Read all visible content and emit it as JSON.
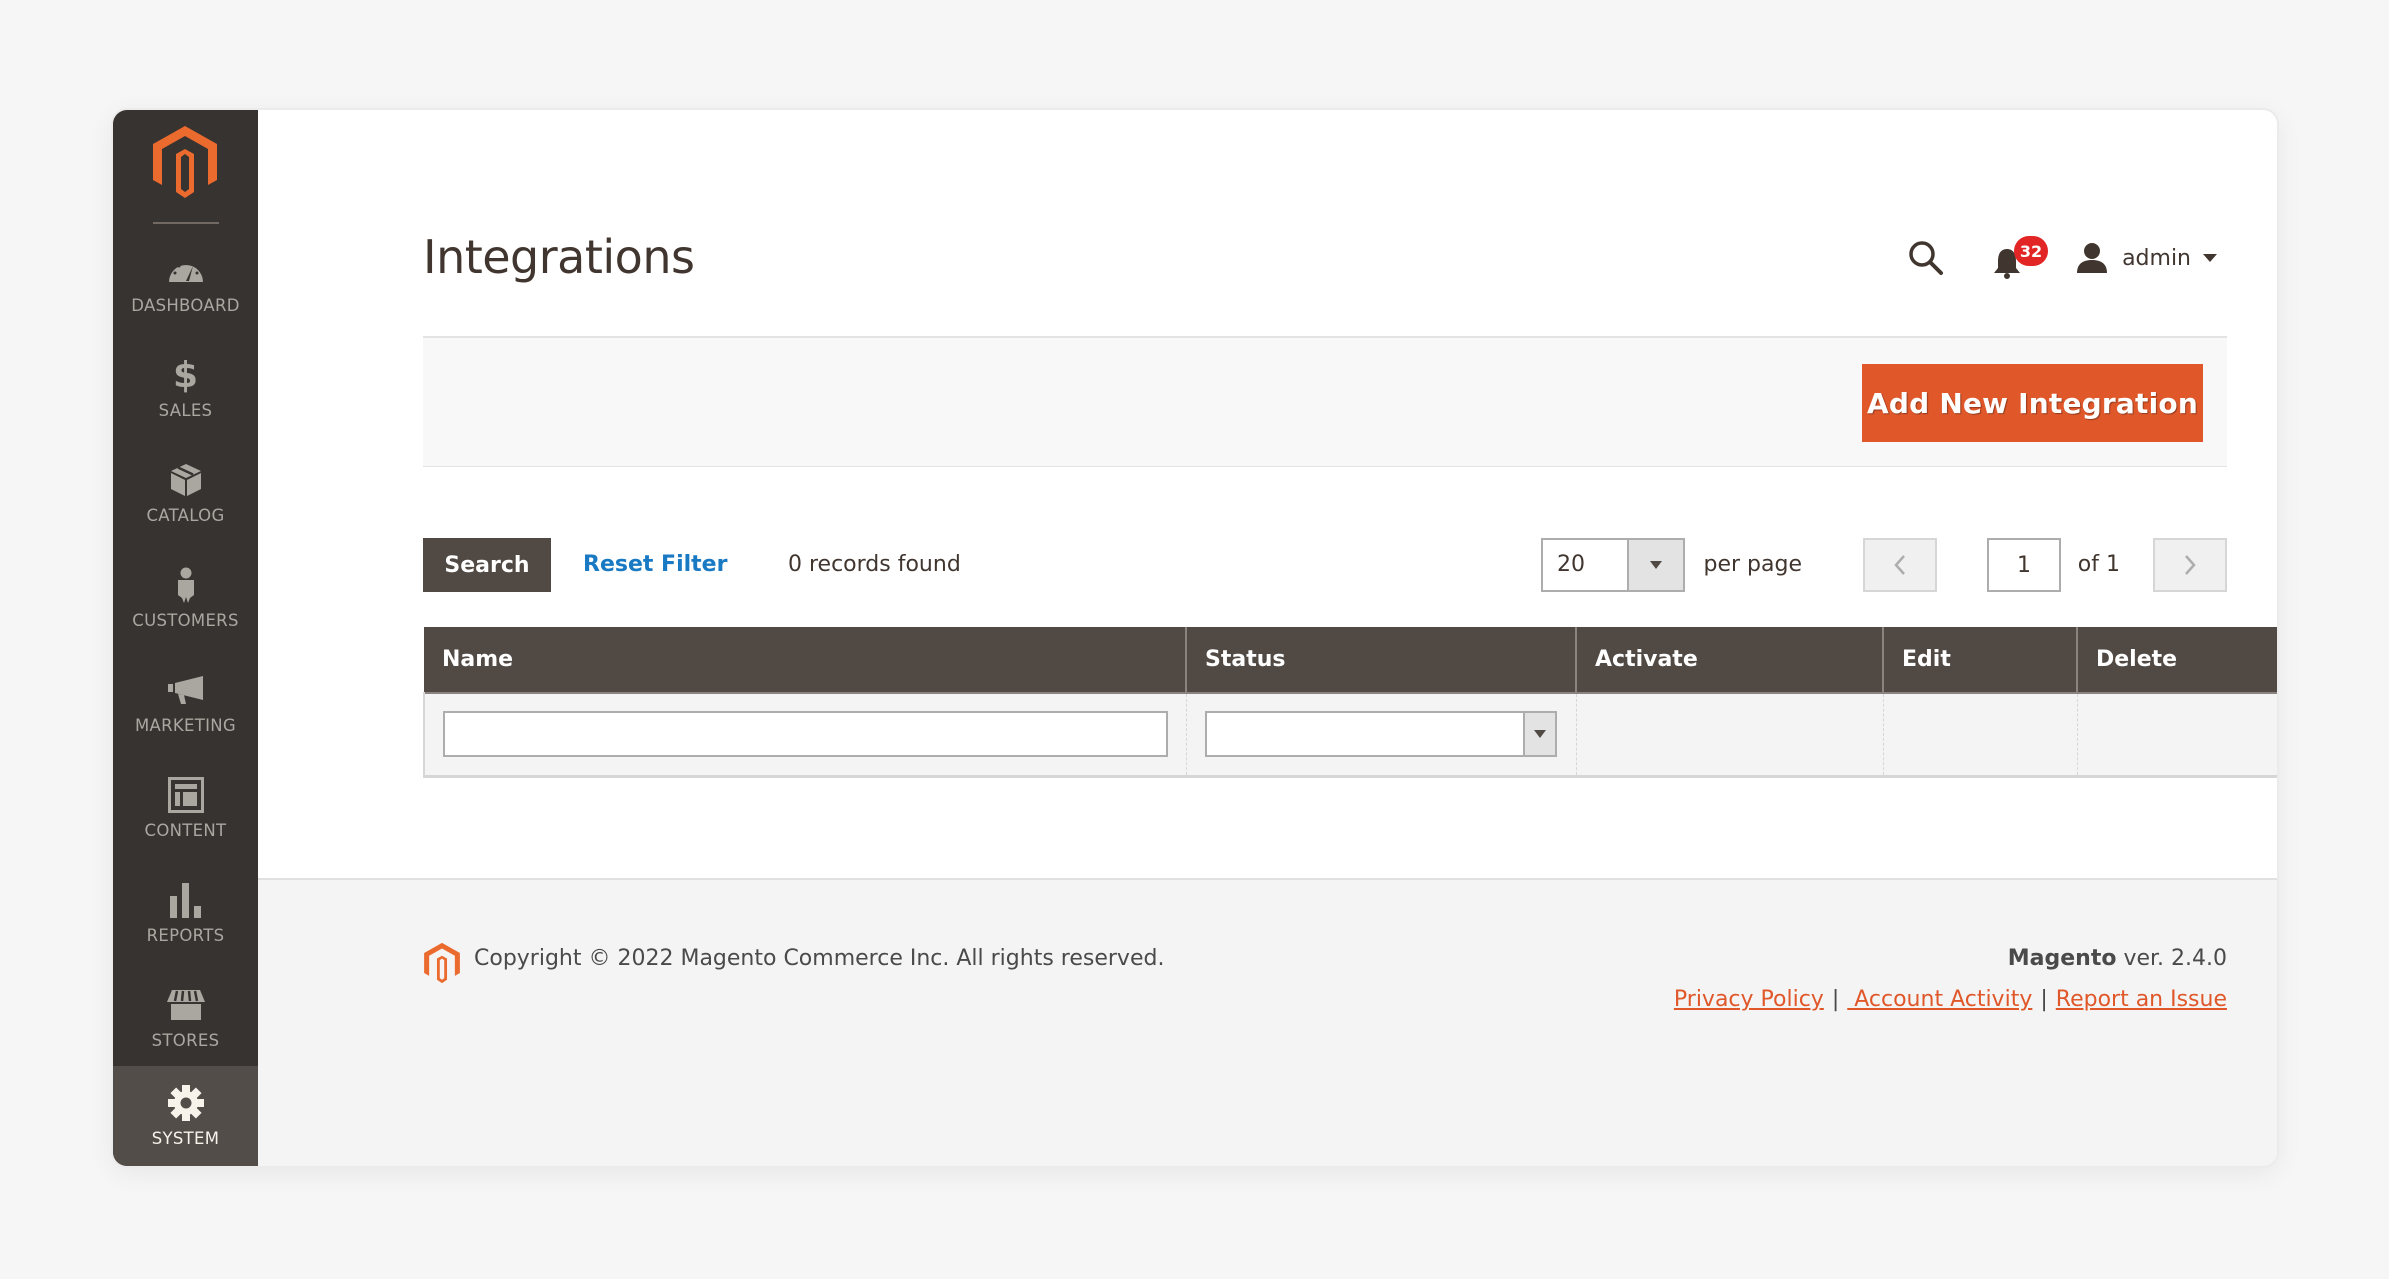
{
  "sidebar": {
    "logo": "magento-logo",
    "items": [
      {
        "id": "dashboard",
        "label": "DASHBOARD",
        "icon": "dashboard-gauge-icon",
        "active": false
      },
      {
        "id": "sales",
        "label": "SALES",
        "icon": "dollar-icon",
        "active": false
      },
      {
        "id": "catalog",
        "label": "CATALOG",
        "icon": "box-icon",
        "active": false
      },
      {
        "id": "customers",
        "label": "CUSTOMERS",
        "icon": "person-icon",
        "active": false
      },
      {
        "id": "marketing",
        "label": "MARKETING",
        "icon": "megaphone-icon",
        "active": false
      },
      {
        "id": "content",
        "label": "CONTENT",
        "icon": "layout-icon",
        "active": false
      },
      {
        "id": "reports",
        "label": "REPORTS",
        "icon": "bar-chart-icon",
        "active": false
      },
      {
        "id": "stores",
        "label": "STORES",
        "icon": "storefront-icon",
        "active": false
      },
      {
        "id": "system",
        "label": "SYSTEM",
        "icon": "gear-icon",
        "active": true
      }
    ]
  },
  "header": {
    "title": "Integrations",
    "notifications_count": "32",
    "user_name": "admin"
  },
  "actions": {
    "add_button": "Add New Integration"
  },
  "grid_toolbar": {
    "search_button": "Search",
    "reset_filter": "Reset Filter",
    "records_found": "0 records found",
    "per_page_value": "20",
    "per_page_label": "per page",
    "current_page": "1",
    "total_pages_label": "of 1"
  },
  "table": {
    "columns": [
      "Name",
      "Status",
      "Activate",
      "Edit",
      "Delete"
    ],
    "filters": {
      "name_value": "",
      "status_value": ""
    }
  },
  "footer": {
    "copyright": "Copyright © 2022 Magento Commerce Inc. All rights reserved.",
    "brand": "Magento",
    "version": " ver. 2.4.0",
    "links": [
      "Privacy Policy",
      " Account Activity",
      "Report an Issue"
    ]
  },
  "colors": {
    "accent": "#e0582a",
    "sidebar_bg": "#373330",
    "sidebar_active": "#524d49",
    "table_header": "#514943",
    "link_blue": "#1979c3",
    "badge_red": "#e22626"
  }
}
